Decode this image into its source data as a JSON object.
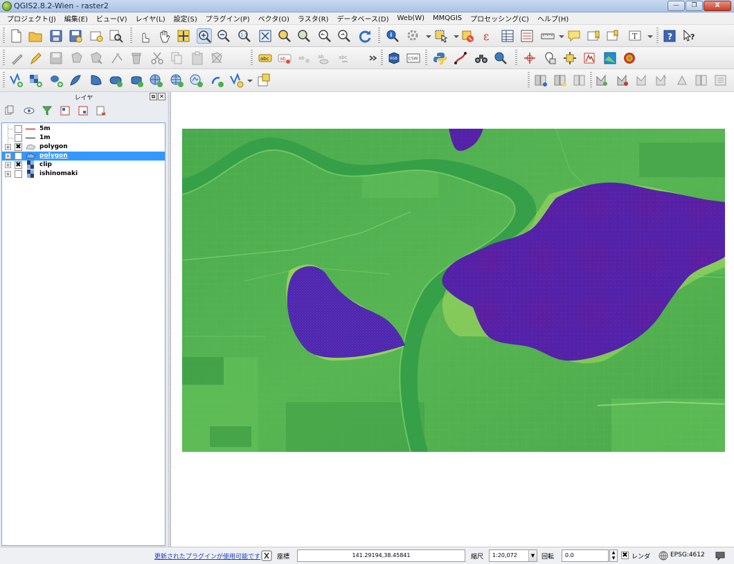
{
  "window": {
    "title": "QGIS2.8.2-Wien - raster2",
    "minimize": "—",
    "maximize": "❐",
    "close": "X"
  },
  "menu": [
    "プロジェクト(J)",
    "編集(E)",
    "ビュー(V)",
    "レイヤ(L)",
    "設定(S)",
    "プラグイン(P)",
    "ベクタ(O)",
    "ラスタ(R)",
    "データベース(D)",
    "Web(W)",
    "MMQGIS",
    "プロセッシング(C)",
    "ヘルプ(H)"
  ],
  "layers_panel": {
    "title": "レイヤ",
    "float_button": "⧉",
    "close_button": "✕",
    "layers": [
      {
        "name": "5m",
        "checked": false,
        "symbol": "line",
        "color": "#c0392b"
      },
      {
        "name": "1m",
        "checked": false,
        "symbol": "line",
        "color": "#555555"
      },
      {
        "name": "polygon",
        "checked": true,
        "symbol": "polygon",
        "expandable": true
      },
      {
        "name": "polygon",
        "checked": false,
        "symbol": "polygon-blue",
        "expandable": true,
        "selected": true
      },
      {
        "name": "clip",
        "checked": true,
        "symbol": "raster",
        "expandable": true
      },
      {
        "name": "ishinomaki",
        "checked": false,
        "symbol": "raster",
        "expandable": true
      }
    ]
  },
  "statusbar": {
    "plugin_notice": "更新されたプラグインが使用可能です",
    "coord_label": "座標",
    "coord_value": "141.29194,38.45841",
    "scale_label": "縮尺",
    "scale_value": "1:20,072",
    "rotation_label": "回転",
    "rotation_value": "0.0",
    "render_label": "レンダ",
    "render_checked": true,
    "crs": "EPSG:4612"
  },
  "colors": {
    "accent": "#3399ff",
    "raster_green": "#46a84a",
    "raster_purple": "#5a1fa3",
    "link": "#1a3ec7"
  }
}
